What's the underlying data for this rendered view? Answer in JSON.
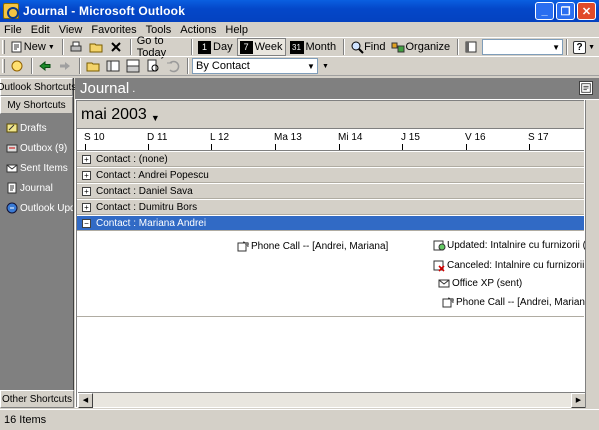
{
  "window": {
    "title": "Journal - Microsoft Outlook",
    "colors": {
      "titlebar": "#0447c9",
      "selection": "#316ac5"
    }
  },
  "menu": [
    "File",
    "Edit",
    "View",
    "Favorites",
    "Tools",
    "Actions",
    "Help"
  ],
  "toolbar": {
    "new_label": "New",
    "go_to_today": "Go to Today",
    "day": "Day",
    "week": "Week",
    "month": "Month",
    "find": "Find",
    "organize": "Organize",
    "search_value": "",
    "view_select": "By Contact",
    "day_icon_num": "1",
    "week_icon_num": "7",
    "month_icon_num": "31"
  },
  "shortcuts": {
    "header": "Outlook Shortcuts",
    "subheader": "My Shortcuts",
    "items": [
      {
        "label": "Drafts",
        "icon": "drafts-icon"
      },
      {
        "label": "Outbox (9)",
        "icon": "outbox-icon"
      },
      {
        "label": "Sent Items",
        "icon": "sent-items-icon"
      },
      {
        "label": "Journal",
        "icon": "journal-icon"
      },
      {
        "label": "Outlook Upda",
        "icon": "outlook-update-icon"
      }
    ],
    "footer": "Other Shortcuts"
  },
  "folder": {
    "title": "Journal",
    "caret": "."
  },
  "timeline": {
    "month": "mai 2003",
    "days": [
      "S 10",
      "D 11",
      "L 12",
      "Ma 13",
      "Mi 14",
      "J 15",
      "V 16",
      "S 17"
    ],
    "groups": [
      "Contact : (none)",
      "Contact : Andrei Popescu",
      "Contact : Daniel Sava",
      "Contact : Dumitru Bors",
      "Contact : Mariana Andrei"
    ],
    "entries": [
      {
        "label": "Phone Call -- [Andrei, Mariana]",
        "icon": "phone-call-icon"
      },
      {
        "label": "Updated: Intalnire cu furnizorii (sent)",
        "icon": "meeting-update-icon"
      },
      {
        "label": "Canceled: Intalnire cu furnizorii (sent)",
        "icon": "meeting-canceled-icon"
      },
      {
        "label": "Office XP (sent)",
        "icon": "email-icon"
      },
      {
        "label": "Phone Call -- [Andrei, Mariana]",
        "icon": "phone-call-icon"
      }
    ]
  },
  "status": {
    "text": "16 Items"
  }
}
